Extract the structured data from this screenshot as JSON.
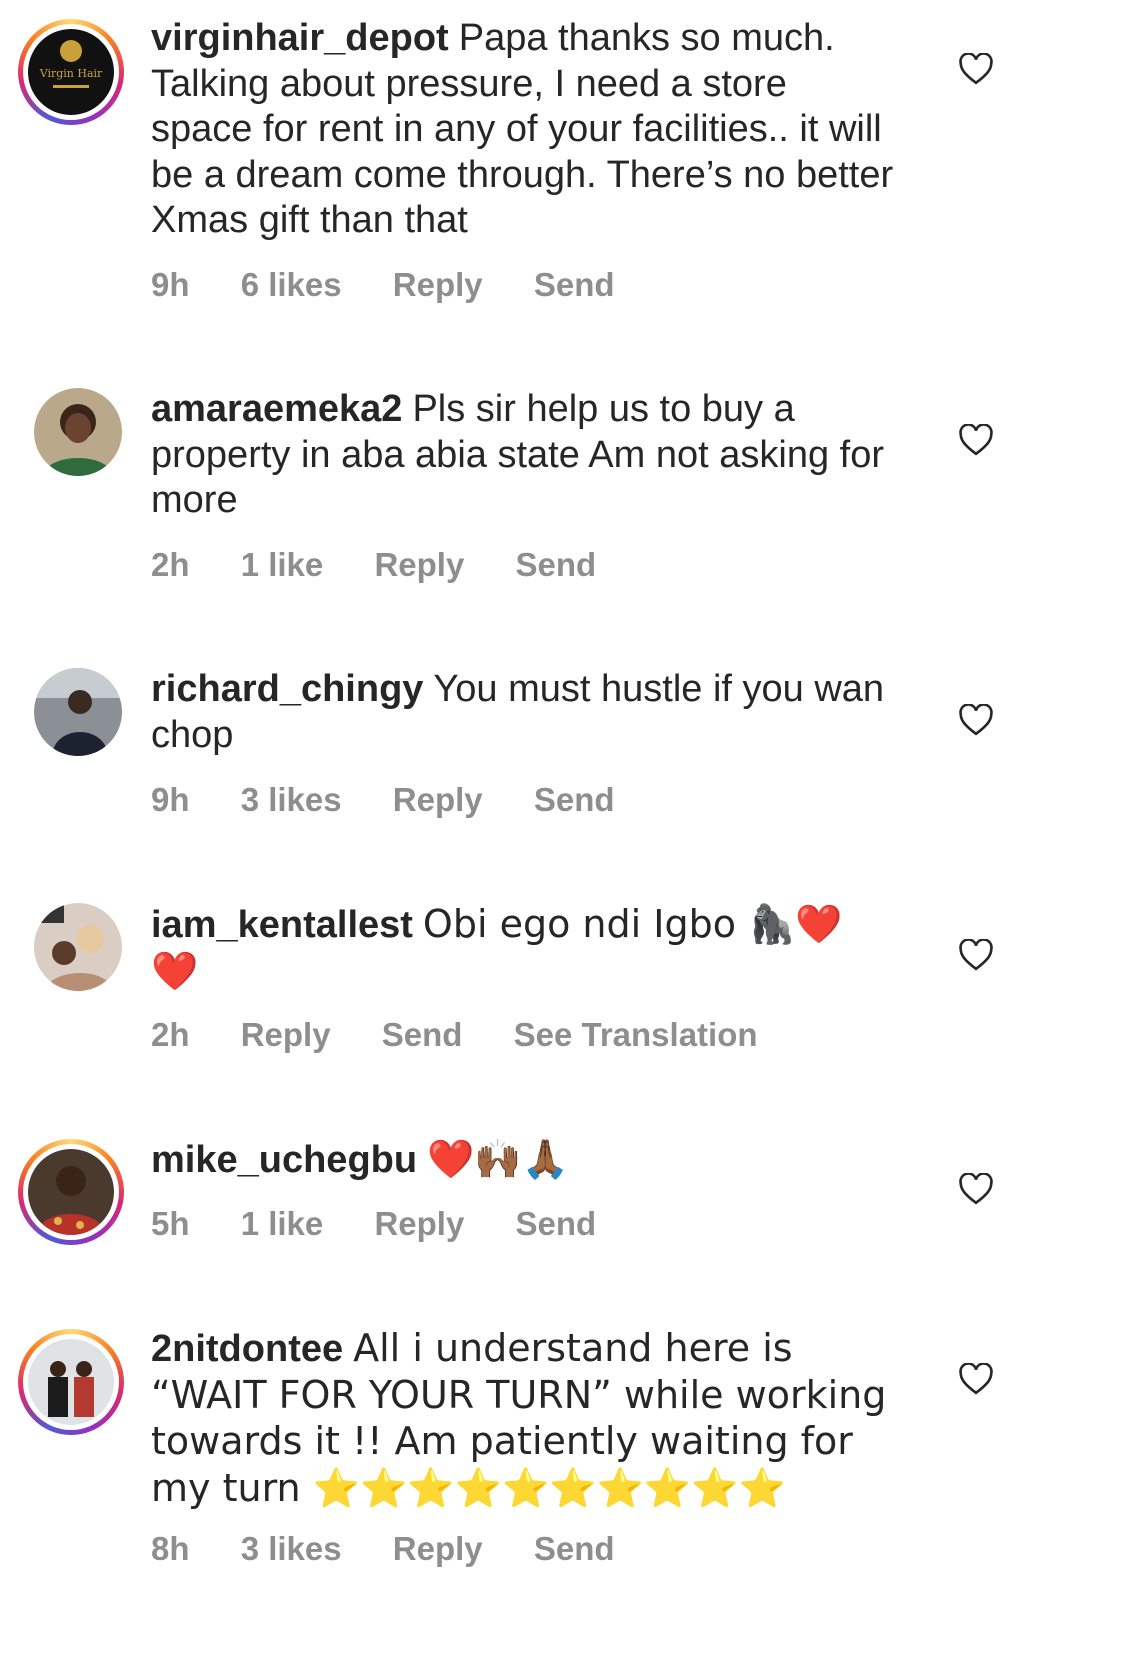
{
  "comments": [
    {
      "username": "virginhair_depot",
      "text": "Papa thanks so much. Talking about pressure, I need a store space for rent in any of your facilities.. it will be a dream come through. There’s no better Xmas gift than that",
      "time": "9h",
      "likes": "6 likes",
      "reply": "Reply",
      "send": "Send",
      "avatar_text": "Virgin Hair"
    },
    {
      "username": "amaraemeka2",
      "text": "Pls sir help us to buy a property in aba abia state Am not asking for more",
      "time": "2h",
      "likes": "1 like",
      "reply": "Reply",
      "send": "Send"
    },
    {
      "username": "richard_chingy",
      "text": "You must hustle if you wan chop",
      "time": "9h",
      "likes": "3 likes",
      "reply": "Reply",
      "send": "Send"
    },
    {
      "username": "iam_kentallest",
      "text": "Obi ego ndi Igbo 🦍❤️ ❤️",
      "time": "2h",
      "reply": "Reply",
      "send": "Send",
      "translation": "See Translation"
    },
    {
      "username": "mike_uchegbu",
      "text": "❤️🙌🏾🙏🏾",
      "time": "5h",
      "likes": "1 like",
      "reply": "Reply",
      "send": "Send"
    },
    {
      "username": "2nitdontee",
      "text": "All i understand here is “WAIT FOR YOUR TURN”  while working towards it !! Am patiently waiting for my turn ⭐️⭐️⭐️⭐️⭐️⭐️⭐️⭐️⭐️⭐️",
      "time": "8h",
      "likes": "3 likes",
      "reply": "Reply",
      "send": "Send"
    }
  ],
  "icons": {
    "like": "heart-outline-icon"
  },
  "colors": {
    "text": "#262626",
    "meta": "#8e8e8e",
    "ring": "#d62976"
  }
}
